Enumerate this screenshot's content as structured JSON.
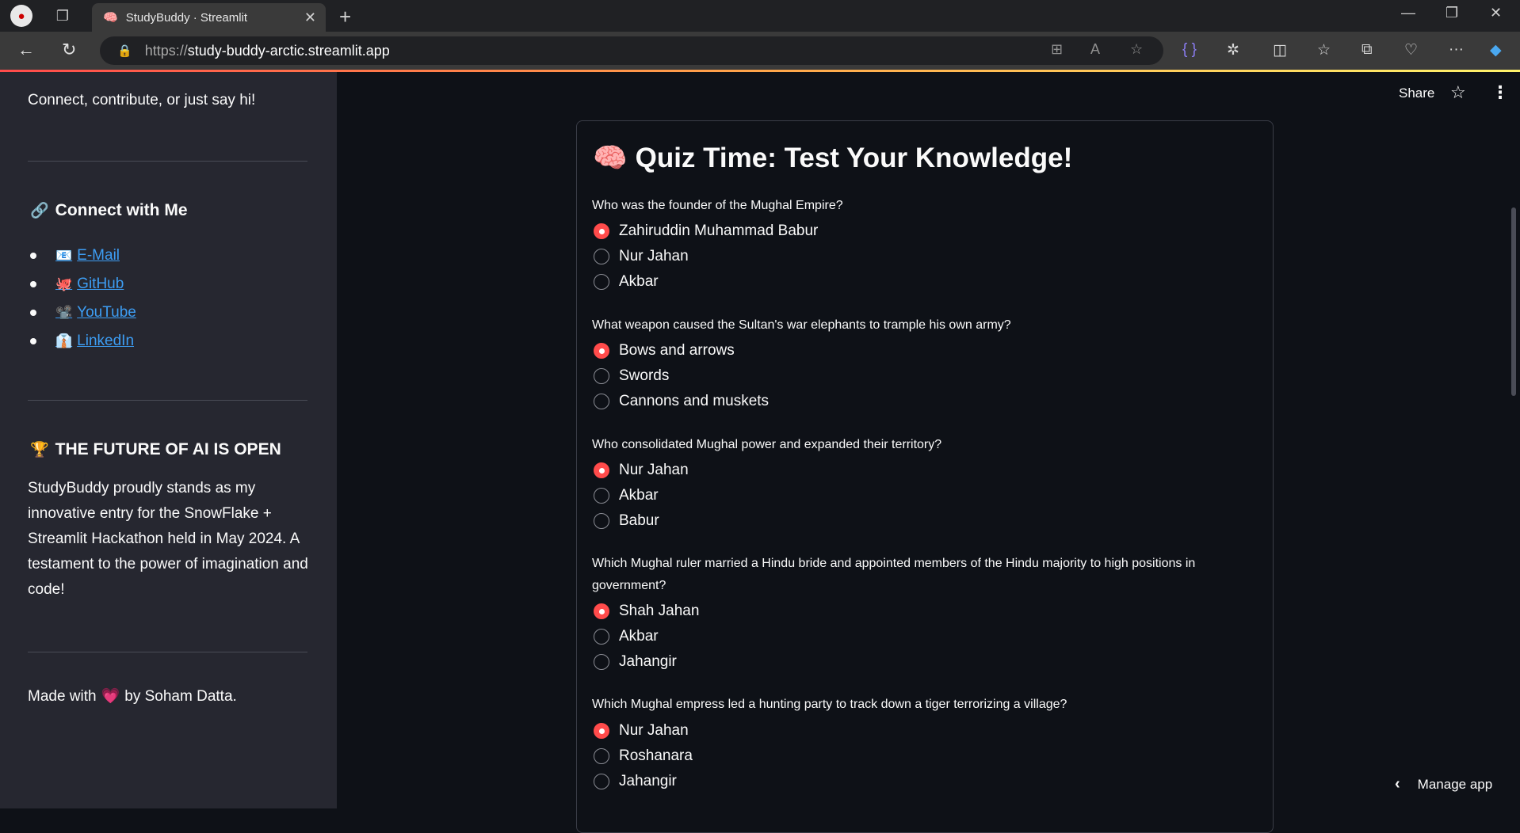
{
  "browser": {
    "tab_title": "StudyBuddy · Streamlit",
    "tab_favicon": "🧠",
    "url_prefix": "https://",
    "url_domain": "study-buddy-arctic.streamlit.app"
  },
  "sidebar": {
    "intro": "Connect, contribute, or just say hi!",
    "connect_heading": "Connect with Me",
    "connect_icon": "🔗",
    "links": [
      {
        "icon": "📧",
        "label": "E-Mail"
      },
      {
        "icon": "🐙",
        "label": "GitHub"
      },
      {
        "icon": "📽️",
        "label": "YouTube"
      },
      {
        "icon": "👔",
        "label": "LinkedIn"
      }
    ],
    "future_heading": "THE FUTURE OF AI IS OPEN",
    "future_icon": "🏆",
    "future_text": "StudyBuddy proudly stands as my innovative entry for the SnowFlake + Streamlit Hackathon held in May 2024. A testament to the power of imagination and code!",
    "made_prefix": "Made with",
    "made_heart": "💗",
    "made_suffix": "by Soham Datta."
  },
  "header": {
    "share_label": "Share"
  },
  "quiz": {
    "icon": "🧠",
    "title": "Quiz Time: Test Your Knowledge!",
    "questions": [
      {
        "text": "Who was the founder of the Mughal Empire?",
        "options": [
          "Zahiruddin Muhammad Babur",
          "Nur Jahan",
          "Akbar"
        ],
        "selected": 0
      },
      {
        "text": "What weapon caused the Sultan's war elephants to trample his own army?",
        "options": [
          "Bows and arrows",
          "Swords",
          "Cannons and muskets"
        ],
        "selected": 0
      },
      {
        "text": "Who consolidated Mughal power and expanded their territory?",
        "options": [
          "Nur Jahan",
          "Akbar",
          "Babur"
        ],
        "selected": 0
      },
      {
        "text": "Which Mughal ruler married a Hindu bride and appointed members of the Hindu majority to high positions in government?",
        "options": [
          "Shah Jahan",
          "Akbar",
          "Jahangir"
        ],
        "selected": 0
      },
      {
        "text": "Which Mughal empress led a hunting party to track down a tiger terrorizing a village?",
        "options": [
          "Nur Jahan",
          "Roshanara",
          "Jahangir"
        ],
        "selected": 0
      }
    ]
  },
  "footer": {
    "manage_label": "Manage app"
  },
  "colors": {
    "accent": "#ff4b4b",
    "link": "#3d9df3",
    "sidebar_bg": "#262730",
    "main_bg": "#0e1117"
  }
}
